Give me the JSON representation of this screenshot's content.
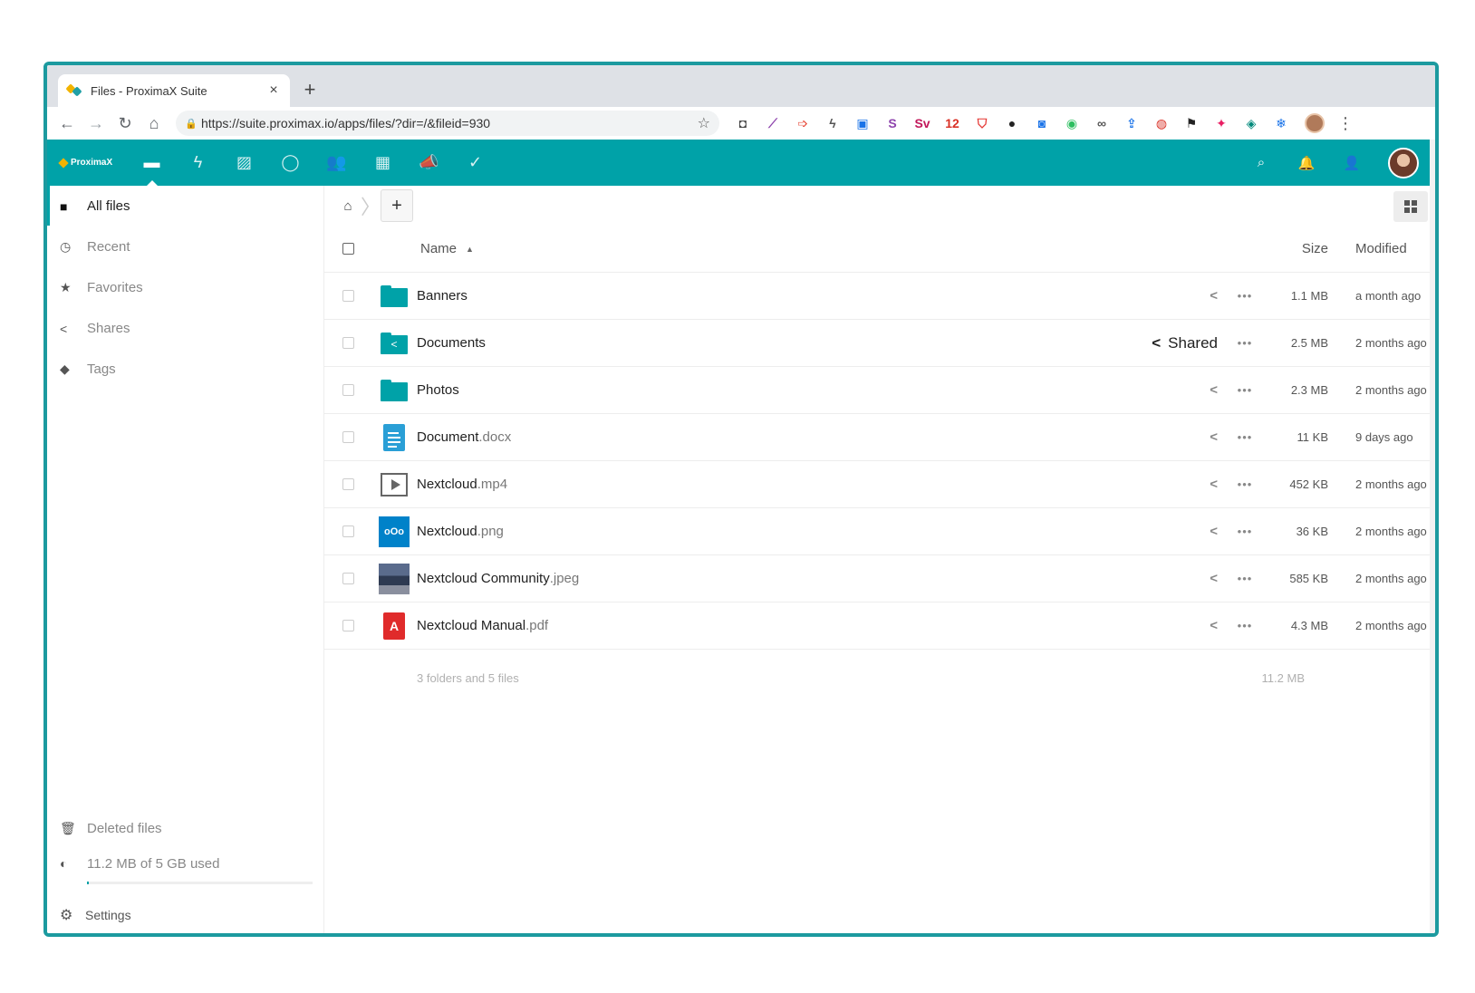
{
  "browser": {
    "tab_title": "Files - ProximaX Suite",
    "tab_close": "×",
    "new_tab": "+",
    "url": "https://suite.proximax.io/apps/files/?dir=/&fileid=930",
    "nav": {
      "back": "←",
      "forward": "→",
      "reload": "↻",
      "home": "⌂"
    },
    "star": "☆",
    "lock": "🔒",
    "menu": "⋮",
    "extensions": [
      {
        "name": "password-ext-icon",
        "glyph": "◘",
        "color": "#444444"
      },
      {
        "name": "pen-ext-icon",
        "glyph": "⟋",
        "color": "#8e44ad"
      },
      {
        "name": "arrow-ext-icon",
        "glyph": "➩",
        "color": "#e74c3c"
      },
      {
        "name": "lightning-ext-icon",
        "glyph": "ϟ",
        "color": "#555555"
      },
      {
        "name": "window-ext-icon",
        "glyph": "▣",
        "color": "#1a73e8"
      },
      {
        "name": "s-ext-icon",
        "glyph": "S",
        "color": "#8e44ad"
      },
      {
        "name": "sv-ext-icon",
        "glyph": "Sv",
        "color": "#c2185b"
      },
      {
        "name": "calendar-ext-icon",
        "glyph": "12",
        "color": "#d93025"
      },
      {
        "name": "shield-ext-icon",
        "glyph": "⛉",
        "color": "#e53935"
      },
      {
        "name": "circle-ext-icon",
        "glyph": "●",
        "color": "#222222"
      },
      {
        "name": "camera-ext-icon",
        "glyph": "◙",
        "color": "#1a73e8"
      },
      {
        "name": "evernote-ext-icon",
        "glyph": "◉",
        "color": "#2dbe60"
      },
      {
        "name": "glasses-ext-icon",
        "glyph": "∞",
        "color": "#555555"
      },
      {
        "name": "upload-ext-icon",
        "glyph": "⇪",
        "color": "#1a73e8"
      },
      {
        "name": "badge-ext-icon",
        "glyph": "◍",
        "color": "#d93025"
      },
      {
        "name": "flag-ext-icon",
        "glyph": "⚑",
        "color": "#222222"
      },
      {
        "name": "color-ext-icon",
        "glyph": "✦",
        "color": "#e91e63"
      },
      {
        "name": "square-ext-icon",
        "glyph": "◈",
        "color": "#00897b"
      },
      {
        "name": "snow-ext-icon",
        "glyph": "❄",
        "color": "#1a73e8"
      }
    ]
  },
  "app": {
    "logo_text": "ProximaX",
    "accent": "#00a2a8",
    "nav_icons": [
      {
        "name": "files-app-icon",
        "glyph": "▬",
        "active": true
      },
      {
        "name": "activity-app-icon",
        "glyph": "ϟ",
        "active": false
      },
      {
        "name": "gallery-app-icon",
        "glyph": "▨",
        "active": false
      },
      {
        "name": "talk-app-icon",
        "glyph": "◯",
        "active": false
      },
      {
        "name": "contacts-app-icon",
        "glyph": "👥",
        "active": false
      },
      {
        "name": "calendar-app-icon",
        "glyph": "▦",
        "active": false
      },
      {
        "name": "announcements-app-icon",
        "glyph": "📣",
        "active": false
      },
      {
        "name": "tasks-app-icon",
        "glyph": "✓",
        "active": false
      }
    ],
    "header_right": {
      "search": "⌕",
      "notifications": "🔔",
      "contacts": "👤"
    }
  },
  "sidebar": {
    "items": [
      {
        "label": "All files",
        "icon": "■",
        "active": true,
        "name": "sidebar-item-all-files"
      },
      {
        "label": "Recent",
        "icon": "◷",
        "active": false,
        "name": "sidebar-item-recent"
      },
      {
        "label": "Favorites",
        "icon": "★",
        "active": false,
        "name": "sidebar-item-favorites"
      },
      {
        "label": "Shares",
        "icon": "<",
        "active": false,
        "name": "sidebar-item-shares"
      },
      {
        "label": "Tags",
        "icon": "◆",
        "active": false,
        "name": "sidebar-item-tags"
      }
    ],
    "deleted_label": "Deleted files",
    "deleted_icon": "🗑",
    "quota_label": "11.2 MB of 5 GB used",
    "quota_icon": "◐",
    "settings_label": "Settings",
    "settings_icon": "⚙"
  },
  "files": {
    "home_crumb": "⌂",
    "add": "+",
    "columns": {
      "name": "Name",
      "size": "Size",
      "modified": "Modified",
      "sort_indicator": "▲"
    },
    "rows": [
      {
        "base": "Banners",
        "ext": "",
        "type": "folder",
        "shared": false,
        "size": "1.1 MB",
        "modified": "a month ago"
      },
      {
        "base": "Documents",
        "ext": "",
        "type": "shared-folder",
        "shared": true,
        "size": "2.5 MB",
        "modified": "2 months ago"
      },
      {
        "base": "Photos",
        "ext": "",
        "type": "folder",
        "shared": false,
        "size": "2.3 MB",
        "modified": "2 months ago"
      },
      {
        "base": "Document",
        "ext": ".docx",
        "type": "doc",
        "shared": false,
        "size": "11 KB",
        "modified": "9 days ago"
      },
      {
        "base": "Nextcloud",
        "ext": ".mp4",
        "type": "video",
        "shared": false,
        "size": "452 KB",
        "modified": "2 months ago"
      },
      {
        "base": "Nextcloud",
        "ext": ".png",
        "type": "png",
        "shared": false,
        "size": "36 KB",
        "modified": "2 months ago"
      },
      {
        "base": "Nextcloud Community",
        "ext": ".jpeg",
        "type": "jpeg",
        "shared": false,
        "size": "585 KB",
        "modified": "2 months ago"
      },
      {
        "base": "Nextcloud Manual",
        "ext": ".pdf",
        "type": "pdf",
        "shared": false,
        "size": "4.3 MB",
        "modified": "2 months ago"
      }
    ],
    "shared_label": "Shared",
    "share_glyph": "<",
    "more_glyph": "•••",
    "summary": "3 folders and 5 files",
    "summary_size": "11.2 MB"
  }
}
